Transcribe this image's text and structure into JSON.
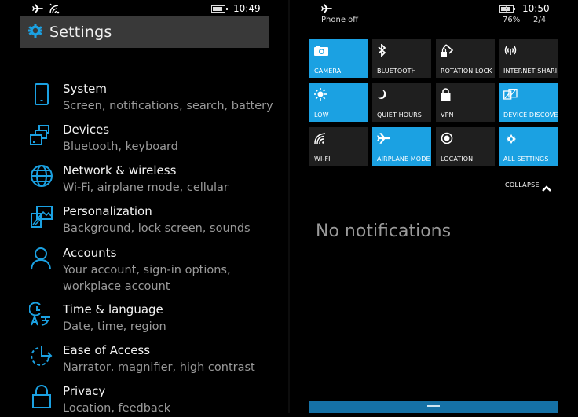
{
  "left_screen": {
    "status_bar": {
      "icons": [
        "airplane-icon",
        "wifi-off-icon",
        "battery-icon"
      ],
      "battery_level": 0.85,
      "time": "10:49"
    },
    "header": {
      "icon": "gear-icon",
      "title": "Settings"
    },
    "items": [
      {
        "icon": "phone-icon",
        "name": "System",
        "desc": "Screen, notifications, search, battery"
      },
      {
        "icon": "devices-icon",
        "name": "Devices",
        "desc": "Bluetooth, keyboard"
      },
      {
        "icon": "globe-icon",
        "name": "Network & wireless",
        "desc": "Wi-Fi, airplane mode, cellular"
      },
      {
        "icon": "personalization-icon",
        "name": "Personalization",
        "desc": "Background, lock screen, sounds"
      },
      {
        "icon": "person-icon",
        "name": "Accounts",
        "desc": "Your account, sign-in options, workplace account"
      },
      {
        "icon": "time-language-icon",
        "name": "Time & language",
        "desc": "Date, time, region"
      },
      {
        "icon": "ease-of-access-icon",
        "name": "Ease of Access",
        "desc": "Narrator, magnifier, high contrast"
      },
      {
        "icon": "lock-icon",
        "name": "Privacy",
        "desc": "Location, feedback"
      }
    ]
  },
  "right_screen": {
    "status_bar": {
      "icons": [
        "airplane-icon",
        "battery-charging-icon"
      ],
      "status_text": "Phone off",
      "battery_percent": "76%",
      "time": "10:50",
      "page": "2/4"
    },
    "quick_actions": [
      {
        "label": "CAMERA",
        "icon": "camera-icon",
        "active": true
      },
      {
        "label": "BLUETOOTH",
        "icon": "bluetooth-icon",
        "active": false
      },
      {
        "label": "ROTATION LOCK",
        "icon": "rotation-lock-icon",
        "active": false
      },
      {
        "label": "INTERNET SHARING",
        "icon": "internet-sharing-icon",
        "active": false
      },
      {
        "label": "LOW",
        "icon": "brightness-icon",
        "active": true
      },
      {
        "label": "QUIET HOURS",
        "icon": "moon-icon",
        "active": false
      },
      {
        "label": "VPN",
        "icon": "lock-icon",
        "active": false
      },
      {
        "label": "DEVICE DISCOVERY",
        "icon": "device-discovery-icon",
        "active": true
      },
      {
        "label": "WI-FI",
        "icon": "wifi-icon",
        "active": false
      },
      {
        "label": "AIRPLANE MODE",
        "icon": "airplane-icon",
        "active": true
      },
      {
        "label": "LOCATION",
        "icon": "location-icon",
        "active": false
      },
      {
        "label": "ALL SETTINGS",
        "icon": "gear-icon",
        "active": true
      }
    ],
    "collapse_label": "COLLAPSE",
    "empty_message": "No notifications"
  },
  "colors": {
    "accent": "#1ba1e2",
    "tile_off": "#1f1f1f",
    "header_bg": "#393939",
    "secondary_text": "#9a9a9a",
    "bottom_bar": "#1571a6"
  }
}
